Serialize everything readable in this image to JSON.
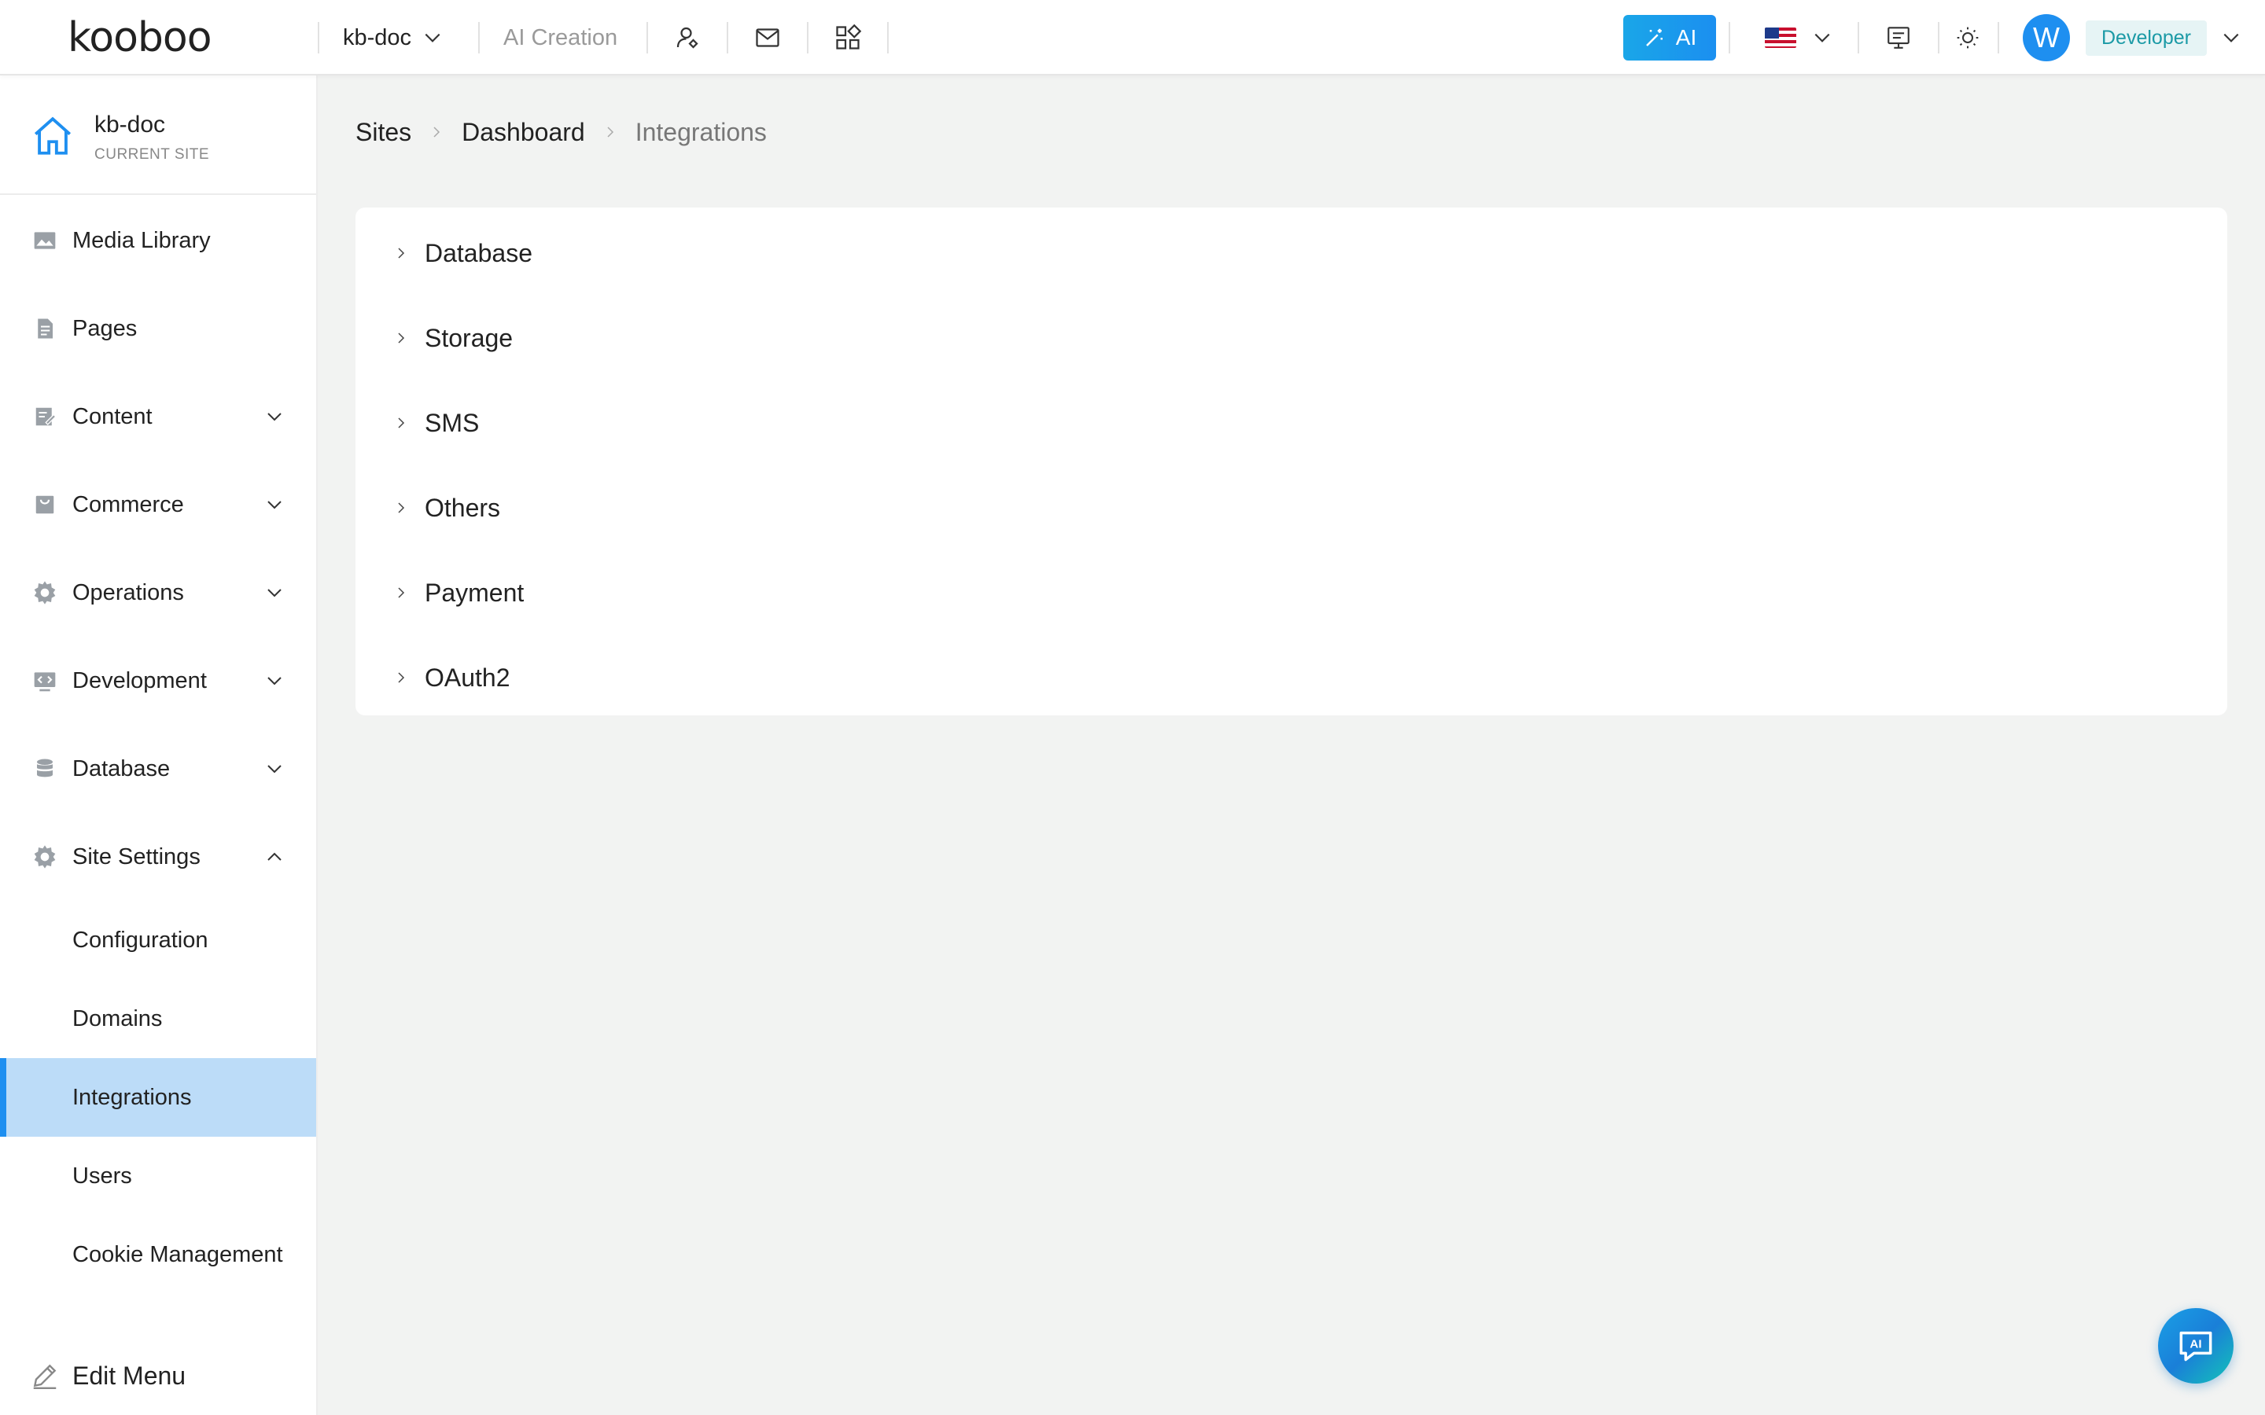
{
  "topbar": {
    "logo_text": "kooboo",
    "site_selector": "kb-doc",
    "ai_creation": "AI Creation",
    "icons": [
      "user-switch-icon",
      "mail-icon",
      "apps-grid-icon",
      "chat-screen-icon",
      "sun-icon"
    ],
    "ai_button": "AI",
    "language": "en-US",
    "avatar_letter": "W",
    "role": "Developer"
  },
  "sidebar": {
    "site_name": "kb-doc",
    "site_sub": "CURRENT SITE",
    "items": [
      {
        "label": "Media Library",
        "icon": "image-icon"
      },
      {
        "label": "Pages",
        "icon": "page-icon"
      },
      {
        "label": "Content",
        "icon": "content-icon",
        "expandable": true
      },
      {
        "label": "Commerce",
        "icon": "commerce-icon",
        "expandable": true
      },
      {
        "label": "Operations",
        "icon": "gear-icon",
        "expandable": true
      },
      {
        "label": "Development",
        "icon": "code-icon",
        "expandable": true
      },
      {
        "label": "Database",
        "icon": "database-icon",
        "expandable": true
      },
      {
        "label": "Site Settings",
        "icon": "gear-icon",
        "expandable": true,
        "expanded": true
      }
    ],
    "sub_items": [
      {
        "label": "Configuration"
      },
      {
        "label": "Domains"
      },
      {
        "label": "Integrations",
        "active": true
      },
      {
        "label": "Users"
      },
      {
        "label": "Cookie Management"
      }
    ],
    "edit_menu": "Edit Menu",
    "accent_color": "#1e8ff0",
    "active_bg": "#bcdcf8"
  },
  "breadcrumb": {
    "items": [
      "Sites",
      "Dashboard"
    ],
    "current": "Integrations"
  },
  "integrations": {
    "sections": [
      "Database",
      "Storage",
      "SMS",
      "Others",
      "Payment",
      "OAuth2"
    ]
  },
  "chat_fab": "AI"
}
